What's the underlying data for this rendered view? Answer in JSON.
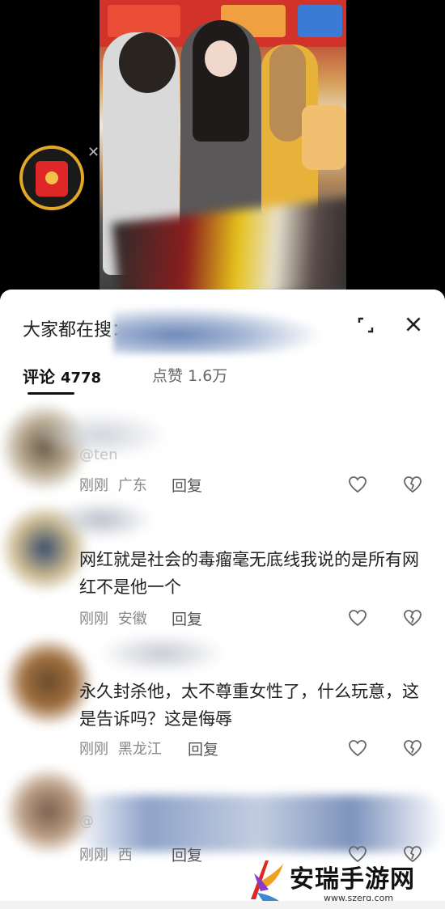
{
  "colors": {
    "accent_gold": "#e3a824",
    "red_packet": "#e02727",
    "text_primary": "#222222",
    "text_secondary": "#888888"
  },
  "sheet": {
    "search_title": "大家都在搜：",
    "icons": {
      "expand": "expand-icon",
      "close": "close-icon"
    }
  },
  "tabs": {
    "comments_label": "评论",
    "comments_count": "4778",
    "likes_label": "点赞",
    "likes_count": "1.6万"
  },
  "comments": [
    {
      "handle": "@ten",
      "text": "",
      "time": "刚刚",
      "location": "广东",
      "reply": "回复"
    },
    {
      "handle": "",
      "text": "网红就是社会的毒瘤毫无底线我说的是所有网红不是他一个",
      "time": "刚刚",
      "location": "安徽",
      "reply": "回复"
    },
    {
      "handle": "",
      "text": "永久封杀他，太不尊重女性了，什么玩意，这是告诉吗？这是侮辱",
      "time": "刚刚",
      "location": "黑龙江",
      "reply": "回复"
    },
    {
      "handle": "@",
      "text": "",
      "time": "刚刚",
      "location": "西",
      "reply": "回复"
    }
  ],
  "watermark": {
    "title": "安瑞手游网",
    "url": "www.szerg.com"
  }
}
